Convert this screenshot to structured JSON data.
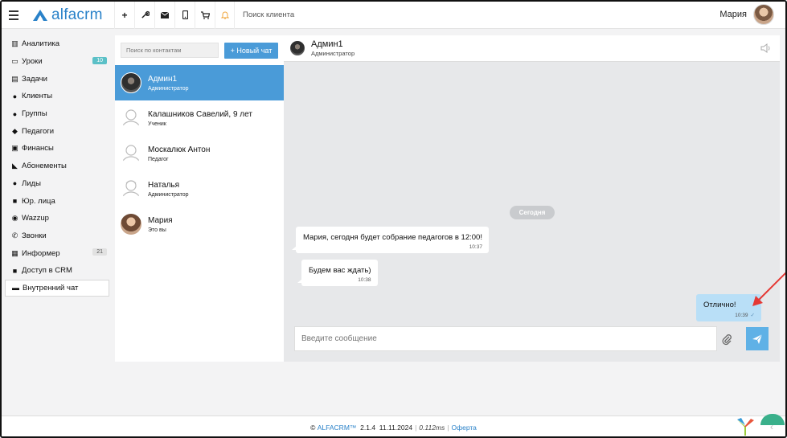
{
  "topbar": {
    "logo_text": "alfacrm",
    "search_placeholder": "Поиск клиента",
    "user_name": "Мария",
    "icons": [
      "plus-icon",
      "wrench-icon",
      "mail-icon",
      "phone-icon",
      "cart-icon",
      "bell-icon"
    ]
  },
  "sidebar": {
    "items": [
      {
        "label": "Аналитика",
        "icon": "map-icon"
      },
      {
        "label": "Уроки",
        "icon": "calendar-icon",
        "badge": "10"
      },
      {
        "label": "Задачи",
        "icon": "clipboard-icon"
      },
      {
        "label": "Клиенты",
        "icon": "user-icon"
      },
      {
        "label": "Группы",
        "icon": "users-icon"
      },
      {
        "label": "Педагоги",
        "icon": "graduation-cap-icon"
      },
      {
        "label": "Финансы",
        "icon": "money-icon"
      },
      {
        "label": "Абонементы",
        "icon": "tag-icon"
      },
      {
        "label": "Лиды",
        "icon": "user-plus-icon"
      },
      {
        "label": "Юр. лица",
        "icon": "briefcase-icon"
      },
      {
        "label": "Wazzup",
        "icon": "whatsapp-icon"
      },
      {
        "label": "Звонки",
        "icon": "phone-icon"
      },
      {
        "label": "Информер",
        "icon": "list-icon",
        "badge": "21"
      },
      {
        "label": "Доступ в CRM",
        "icon": "lock-icon"
      },
      {
        "label": "Внутренний чат",
        "icon": "envelope-icon"
      }
    ]
  },
  "contacts": {
    "search_placeholder": "Поиск по контактам",
    "new_chat_label": "+ Новый чат",
    "list": [
      {
        "name": "Админ1",
        "role": "Администратор"
      },
      {
        "name": "Калашников Савелий, 9 лет",
        "role": "Ученик"
      },
      {
        "name": "Москалюк Антон",
        "role": "Педагог"
      },
      {
        "name": "Наталья",
        "role": "Администратор"
      },
      {
        "name": "Мария",
        "role": "Это вы"
      }
    ]
  },
  "chat": {
    "header_name": "Админ1",
    "header_role": "Администратор",
    "date_label": "Сегодня",
    "messages": [
      {
        "text": "Мария, сегодня будет собрание педагогов в 12:00!",
        "time": "10:37",
        "direction": "in"
      },
      {
        "text": "Будем вас ждать)",
        "time": "10:38",
        "direction": "in"
      },
      {
        "text": "Отлично!",
        "time": "10:39",
        "direction": "out"
      }
    ],
    "composer_placeholder": "Введите сообщение"
  },
  "footer": {
    "copyright": "©",
    "brand": "ALFACRM™",
    "version": "2.1.4",
    "date": "11.11.2024",
    "timing": "0.112ms",
    "offer": "Оферта"
  },
  "colors": {
    "accent": "#4a9bd8",
    "outgoing_bubble": "#b9dff7",
    "badge_teal": "#5bc0c7",
    "annotation_arrow": "#e53935"
  }
}
